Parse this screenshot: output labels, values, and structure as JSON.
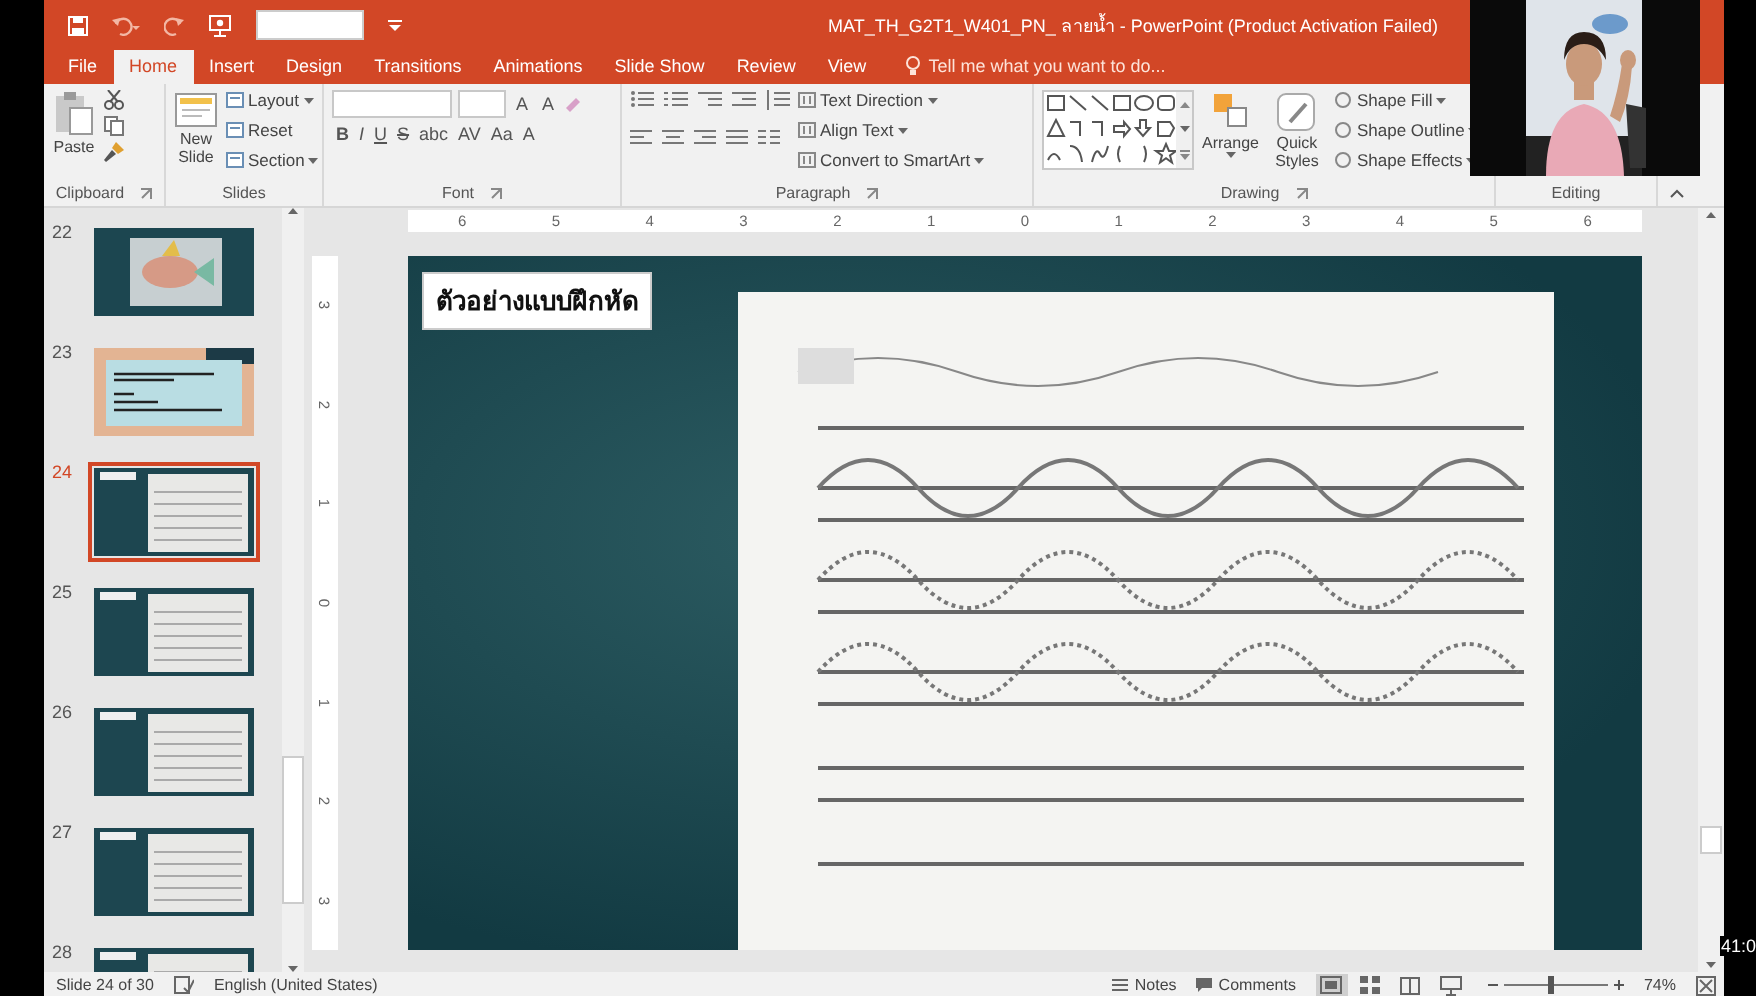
{
  "window": {
    "title": "MAT_TH_G2T1_W401_PN_ ลายน้ำ - PowerPoint (Product Activation Failed)"
  },
  "ribbon_tabs": [
    {
      "label": "File",
      "selected": false
    },
    {
      "label": "Home",
      "selected": true
    },
    {
      "label": "Insert",
      "selected": false
    },
    {
      "label": "Design",
      "selected": false
    },
    {
      "label": "Transitions",
      "selected": false
    },
    {
      "label": "Animations",
      "selected": false
    },
    {
      "label": "Slide Show",
      "selected": false
    },
    {
      "label": "Review",
      "selected": false
    },
    {
      "label": "View",
      "selected": false
    }
  ],
  "tell_me": {
    "placeholder": "Tell me what you want to do..."
  },
  "ribbon": {
    "clipboard": {
      "label": "Clipboard",
      "paste": "Paste"
    },
    "slides": {
      "label": "Slides",
      "new_slide": "New Slide",
      "layout": "Layout",
      "reset": "Reset",
      "section": "Section"
    },
    "font": {
      "label": "Font",
      "size_buttons": [
        "A",
        "A"
      ],
      "format_buttons": [
        "B",
        "I",
        "U",
        "S",
        "abc",
        "AV",
        "Aa",
        "A"
      ]
    },
    "paragraph": {
      "label": "Paragraph",
      "text_direction": "Text Direction",
      "align_text": "Align Text",
      "convert": "Convert to SmartArt"
    },
    "drawing": {
      "label": "Drawing",
      "arrange": "Arrange",
      "quick_styles": "Quick Styles",
      "shape_fill": "Shape Fill",
      "shape_outline": "Shape Outline",
      "shape_effects": "Shape Effects"
    },
    "editing": {
      "label": "Editing"
    }
  },
  "slide_thumbnails": [
    {
      "number": "22",
      "selected": false
    },
    {
      "number": "23",
      "kind": "text",
      "selected": false
    },
    {
      "number": "24",
      "kind": "worksheet",
      "selected": true
    },
    {
      "number": "25",
      "kind": "worksheet",
      "selected": false
    },
    {
      "number": "26",
      "kind": "worksheet",
      "selected": false
    },
    {
      "number": "27",
      "kind": "worksheet",
      "selected": false
    },
    {
      "number": "28",
      "kind": "worksheet",
      "selected": false
    }
  ],
  "rulers": {
    "horizontal": [
      "6",
      "5",
      "4",
      "3",
      "2",
      "1",
      "0",
      "1",
      "2",
      "3",
      "4",
      "5",
      "6"
    ],
    "vertical": [
      "3",
      "2",
      "1",
      "0",
      "1",
      "2",
      "3"
    ]
  },
  "slide": {
    "title": "ตัวอย่างแบบฝึกหัด"
  },
  "status_bar": {
    "slide_info": "Slide 24 of 30",
    "language": "English (United States)",
    "notes": "Notes",
    "comments": "Comments",
    "views": [
      {
        "kind": "normal",
        "selected": true
      },
      {
        "kind": "sorter",
        "selected": false
      },
      {
        "kind": "reading",
        "selected": false
      },
      {
        "kind": "slideshow",
        "selected": false
      }
    ],
    "zoom": {
      "level": 0.46,
      "reading": "74%"
    }
  },
  "timer": "41:0"
}
